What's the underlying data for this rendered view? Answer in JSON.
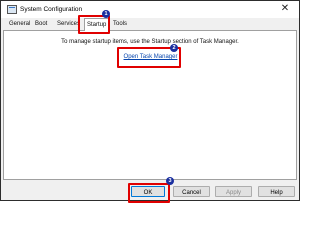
{
  "window": {
    "title": "System Configuration",
    "close_glyph": "✕"
  },
  "tabs": [
    {
      "label": "General"
    },
    {
      "label": "Boot"
    },
    {
      "label": "Services"
    },
    {
      "label": "Startup"
    },
    {
      "label": "Tools"
    }
  ],
  "startup": {
    "message": "To manage startup items, use the Startup section of Task Manager.",
    "link": "Open Task Manager"
  },
  "buttons": {
    "ok": "OK",
    "cancel": "Cancel",
    "apply": "Apply",
    "help": "Help"
  },
  "annotations": [
    {
      "number": "1"
    },
    {
      "number": "2"
    },
    {
      "number": "3"
    }
  ],
  "colors": {
    "highlight": "#e00000",
    "badge": "#1a2fa0",
    "link": "#0645ad"
  }
}
